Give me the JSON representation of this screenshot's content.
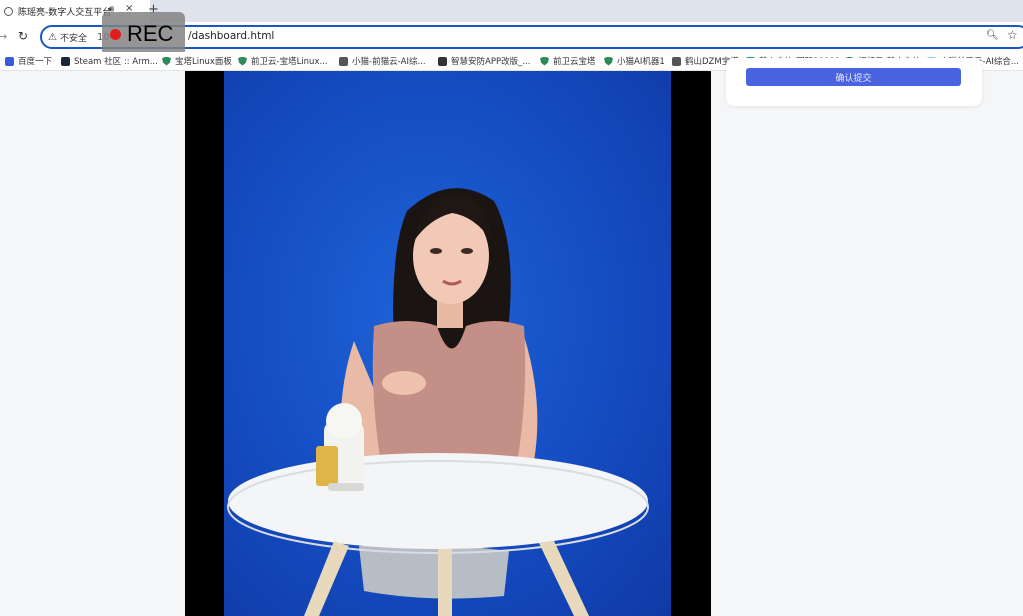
{
  "browser": {
    "tab": {
      "title": "陈瑶亮-数字人交互平台",
      "close_icon": "×",
      "audio_icon": "speaker-icon",
      "new_tab": "+"
    },
    "address": {
      "security_label": "不安全",
      "host_partial": "10",
      "path": "/dashboard.html"
    },
    "recording": {
      "label": "REC",
      "dot_color": "#e11d1d"
    },
    "bookmarks": [
      {
        "label": "百度一下",
        "icon": "baidu-icon"
      },
      {
        "label": "Steam 社区 :: Arm...",
        "icon": "steam-icon"
      },
      {
        "label": "宝塔Linux面板",
        "icon": "shield-icon"
      },
      {
        "label": "前卫云-宝塔Linux...",
        "icon": "shield-icon"
      },
      {
        "label": "小猫-前猫云-AI综...",
        "icon": "globe-icon"
      },
      {
        "label": "智慧安防APP改版_...",
        "icon": "app-icon"
      },
      {
        "label": "前卫云宝塔",
        "icon": "shield-icon"
      },
      {
        "label": "小猫AI机器1",
        "icon": "shield-icon"
      },
      {
        "label": "鹤山DZM宝塔",
        "icon": "globe-icon"
      },
      {
        "label": "鹤山电信-国际28181",
        "icon": "teal-icon"
      },
      {
        "label": "视频云-鹤山电信",
        "icon": "shield-icon"
      },
      {
        "label": "小猫前卫云-AI综合...",
        "icon": "cloud-icon"
      }
    ]
  },
  "page": {
    "side_button_label": "确认提交",
    "accent_color": "#4a63e0",
    "video_background": "#1650c6"
  }
}
